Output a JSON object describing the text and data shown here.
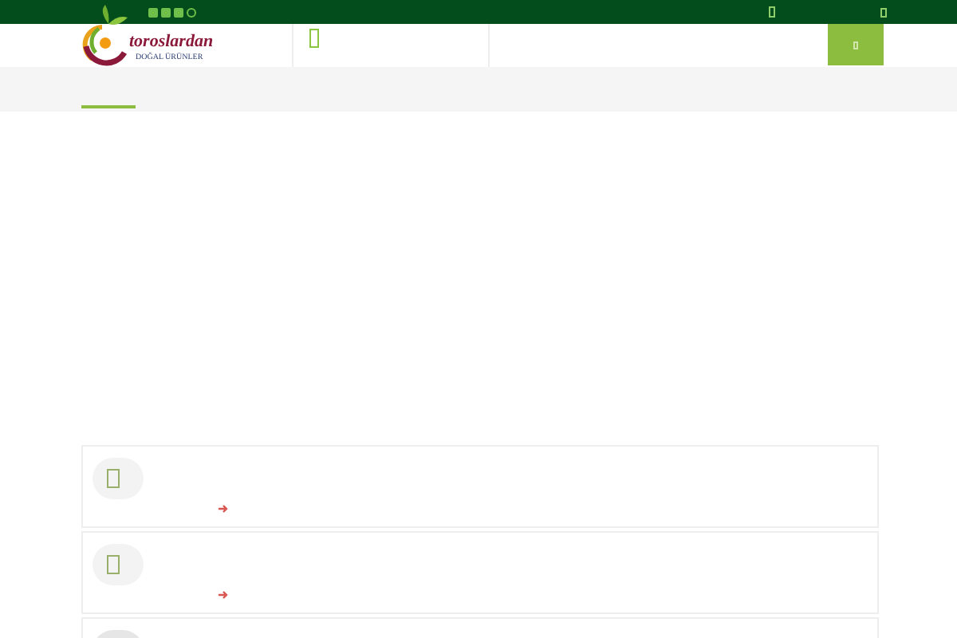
{
  "logo": {
    "name": "toroslardan",
    "tagline": "DOĞAL ÜRÜNLER"
  },
  "cards": [
    {
      "kind": "feature"
    },
    {
      "kind": "feature"
    },
    {
      "kind": "feature"
    }
  ]
}
